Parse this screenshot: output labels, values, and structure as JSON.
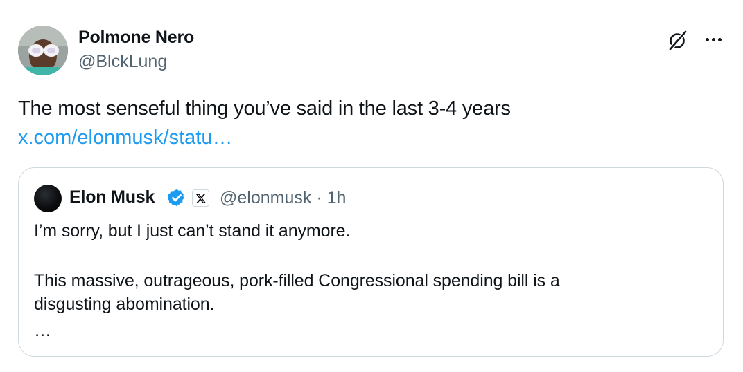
{
  "tweet": {
    "author": {
      "name": "Polmone Nero",
      "handle": "@BlckLung",
      "avatar_icon": "user-avatar-photo"
    },
    "actions": {
      "grok_icon": "grok-icon",
      "more_icon": "more-options-icon"
    },
    "text": "The most senseful thing you’ve said in the last 3-4 years",
    "link": "x.com/elonmusk/statu…",
    "quoted": {
      "author": {
        "name": "Elon Musk",
        "handle": "@elonmusk",
        "verified_icon": "verified-badge-icon",
        "affiliation_icon": "x-logo-icon"
      },
      "time": "1h",
      "separator": "·",
      "lines": [
        "I’m sorry, but I just can’t stand it anymore.",
        "This massive, outrageous, pork-filled Congressional spending bill is a",
        "disgusting abomination.",
        "…"
      ]
    }
  },
  "colors": {
    "text_primary": "#0f1419",
    "text_secondary": "#536471",
    "link": "#1d9bf0",
    "verified": "#1d9bf0",
    "border": "#cfd9de"
  }
}
